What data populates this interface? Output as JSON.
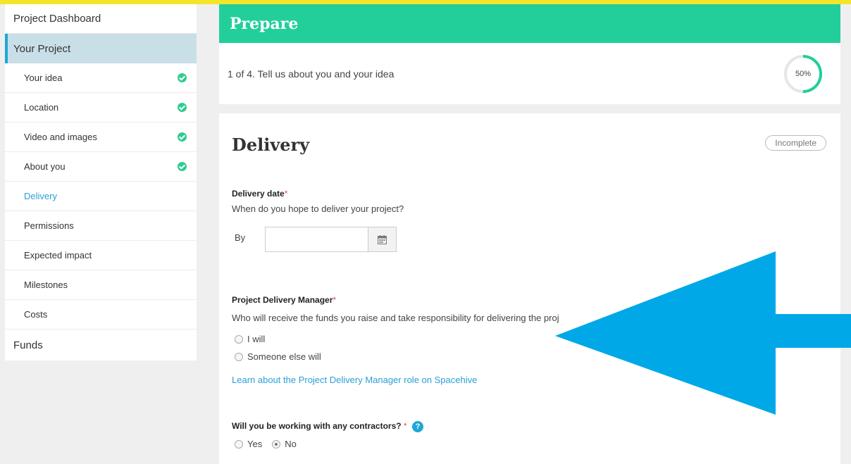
{
  "sidebar": {
    "dashboard": "Project Dashboard",
    "section": "Your Project",
    "items": [
      {
        "label": "Your idea",
        "complete": true
      },
      {
        "label": "Location",
        "complete": true
      },
      {
        "label": "Video and images",
        "complete": true
      },
      {
        "label": "About you",
        "complete": true
      },
      {
        "label": "Delivery",
        "complete": false,
        "active": true
      },
      {
        "label": "Permissions",
        "complete": false
      },
      {
        "label": "Expected impact",
        "complete": false
      },
      {
        "label": "Milestones",
        "complete": false
      },
      {
        "label": "Costs",
        "complete": false
      }
    ],
    "funds": "Funds"
  },
  "header": {
    "title": "Prepare",
    "step_text": "1 of 4. Tell us about you and your idea",
    "progress_label": "50%",
    "progress_value": 0.5
  },
  "panel": {
    "title": "Delivery",
    "status": "Incomplete",
    "delivery_date": {
      "label": "Delivery date",
      "required_mark": "*",
      "hint": "When do you hope to deliver your project?",
      "by_label": "By",
      "value": ""
    },
    "manager": {
      "label": "Project Delivery Manager",
      "required_mark": "*",
      "hint": "Who will receive the funds you raise and take responsibility for delivering the proj",
      "options": [
        "I will",
        "Someone else will"
      ],
      "link": "Learn about the Project Delivery Manager role on Spacehive"
    },
    "contractors": {
      "label": "Will you be working with any contractors?",
      "required_mark": " *",
      "help_icon": "?",
      "options": [
        "Yes",
        "No"
      ],
      "selected": "No"
    }
  },
  "colors": {
    "topbar": "#f2e52a",
    "prepare": "#22cf9b",
    "accent": "#1ea7d6",
    "arrow": "#00a8e8"
  },
  "icons": {
    "check": "check-circle-icon",
    "calendar": "calendar-icon",
    "help": "question-circle-icon"
  }
}
